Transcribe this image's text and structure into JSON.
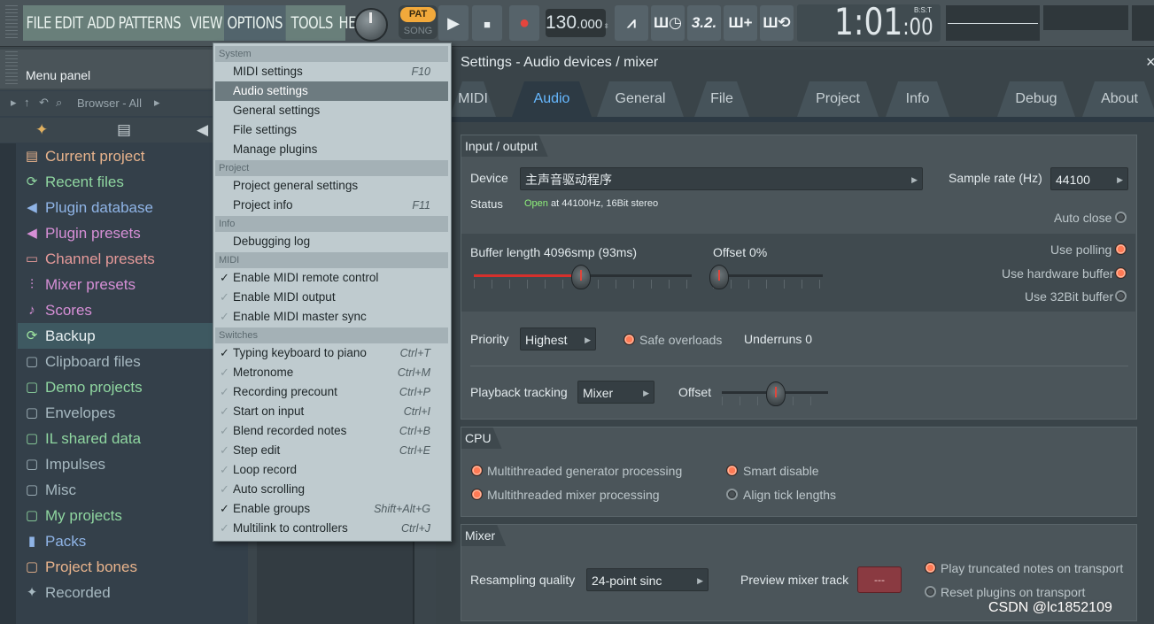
{
  "menubar": {
    "items": [
      "FILE",
      "EDIT",
      "ADD",
      "PATTERNS",
      "VIEW",
      "OPTIONS",
      "TOOLS",
      "HELP"
    ],
    "active": "OPTIONS"
  },
  "transport": {
    "pat_label": "PAT",
    "song_label": "SONG",
    "play_icon": "play-icon",
    "stop_icon": "stop-icon",
    "record_icon": "record-icon",
    "tempo_main": "130",
    "tempo_frac": ".000",
    "time_main": "1:01",
    "time_sub": ":00",
    "time_unit": "B:S:T"
  },
  "menu_panel": {
    "label": "Menu panel"
  },
  "browser": {
    "title": "Browser - All",
    "items": [
      {
        "label": "Current project",
        "color": "#e8b38c",
        "icon": "▤"
      },
      {
        "label": "Recent files",
        "color": "#8fd6a0",
        "icon": "⟳"
      },
      {
        "label": "Plugin database",
        "color": "#8fb4e6",
        "icon": "◀"
      },
      {
        "label": "Plugin presets",
        "color": "#d68fd6",
        "icon": "◀"
      },
      {
        "label": "Channel presets",
        "color": "#e69a9a",
        "icon": "▭"
      },
      {
        "label": "Mixer presets",
        "color": "#d68fd6",
        "icon": "⫶"
      },
      {
        "label": "Scores",
        "color": "#d68fd6",
        "icon": "♪"
      },
      {
        "label": "Backup",
        "color": "#9fe6a0",
        "icon": "⟳"
      },
      {
        "label": "Clipboard files",
        "color": "#a6b8c0",
        "icon": "▢"
      },
      {
        "label": "Demo projects",
        "color": "#8fd6a0",
        "icon": "▢"
      },
      {
        "label": "Envelopes",
        "color": "#a6b8c0",
        "icon": "▢"
      },
      {
        "label": "IL shared data",
        "color": "#8fd6a0",
        "icon": "▢"
      },
      {
        "label": "Impulses",
        "color": "#a6b8c0",
        "icon": "▢"
      },
      {
        "label": "Misc",
        "color": "#a6b8c0",
        "icon": "▢"
      },
      {
        "label": "My projects",
        "color": "#8fd6a0",
        "icon": "▢"
      },
      {
        "label": "Packs",
        "color": "#8fb4e6",
        "icon": "▮"
      },
      {
        "label": "Project bones",
        "color": "#e8b38c",
        "icon": "▢"
      },
      {
        "label": "Recorded",
        "color": "#a6b8c0",
        "icon": "✦"
      }
    ],
    "selected_index": 7
  },
  "dropdown": {
    "sections": [
      {
        "header": "System",
        "items": [
          {
            "label": "MIDI settings",
            "shortcut": "F10"
          },
          {
            "label": "Audio settings",
            "shortcut": "",
            "highlight": true
          },
          {
            "label": "General settings",
            "shortcut": ""
          },
          {
            "label": "File settings",
            "shortcut": ""
          },
          {
            "label": "Manage plugins",
            "shortcut": ""
          }
        ]
      },
      {
        "header": "Project",
        "items": [
          {
            "label": "Project general settings",
            "shortcut": ""
          },
          {
            "label": "Project info",
            "shortcut": "F11"
          }
        ]
      },
      {
        "header": "Info",
        "items": [
          {
            "label": "Debugging log",
            "shortcut": ""
          }
        ]
      },
      {
        "header": "MIDI",
        "items": [
          {
            "label": "Enable MIDI remote control",
            "shortcut": "",
            "check": "on"
          },
          {
            "label": "Enable MIDI output",
            "shortcut": "",
            "check": "off"
          },
          {
            "label": "Enable MIDI master sync",
            "shortcut": "",
            "check": "off"
          }
        ]
      },
      {
        "header": "Switches",
        "items": [
          {
            "label": "Typing keyboard to piano",
            "shortcut": "Ctrl+T",
            "check": "on"
          },
          {
            "label": "Metronome",
            "shortcut": "Ctrl+M",
            "check": "off"
          },
          {
            "label": "Recording precount",
            "shortcut": "Ctrl+P",
            "check": "off"
          },
          {
            "label": "Start on input",
            "shortcut": "Ctrl+I",
            "check": "off"
          },
          {
            "label": "Blend recorded notes",
            "shortcut": "Ctrl+B",
            "check": "off"
          },
          {
            "label": "Step edit",
            "shortcut": "Ctrl+E",
            "check": "off"
          },
          {
            "label": "Loop record",
            "shortcut": "",
            "check": "off"
          },
          {
            "label": "Auto scrolling",
            "shortcut": "",
            "check": "off"
          },
          {
            "label": "Enable groups",
            "shortcut": "Shift+Alt+G",
            "check": "on"
          },
          {
            "label": "Multilink to controllers",
            "shortcut": "Ctrl+J",
            "check": "off"
          }
        ]
      }
    ]
  },
  "settings": {
    "title": "Settings - Audio devices / mixer",
    "tabs": [
      "MIDI",
      "Audio",
      "General",
      "File",
      "Project",
      "Info",
      "Debug",
      "About"
    ],
    "active_tab": "Audio",
    "io": {
      "header": "Input / output",
      "device_label": "Device",
      "device_value": "主声音驱动程序",
      "sample_rate_label": "Sample rate (Hz)",
      "sample_rate_value": "44100",
      "status_label": "Status",
      "status_open": "Open",
      "status_rest": "at 44100Hz, 16Bit stereo",
      "auto_close": "Auto close",
      "buffer_label": "Buffer length 4096smp (93ms)",
      "offset_label": "Offset 0%",
      "use_polling": "Use polling",
      "use_hw_buffer": "Use hardware buffer",
      "use_32bit": "Use 32Bit buffer",
      "priority_label": "Priority",
      "priority_value": "Highest",
      "safe_overloads": "Safe overloads",
      "underruns": "Underruns 0",
      "playback_label": "Playback tracking",
      "playback_value": "Mixer",
      "pb_offset_label": "Offset"
    },
    "cpu": {
      "header": "CPU",
      "mt_gen": "Multithreaded generator processing",
      "mt_mix": "Multithreaded mixer processing",
      "smart_disable": "Smart disable",
      "align_tick": "Align tick lengths"
    },
    "mixer": {
      "header": "Mixer",
      "resampling_label": "Resampling quality",
      "resampling_value": "24-point sinc",
      "preview_label": "Preview mixer track",
      "preview_value": "---",
      "play_truncated": "Play truncated notes on transport",
      "reset_plugins": "Reset plugins on transport"
    }
  },
  "watermark": "CSDN @lc1852109"
}
